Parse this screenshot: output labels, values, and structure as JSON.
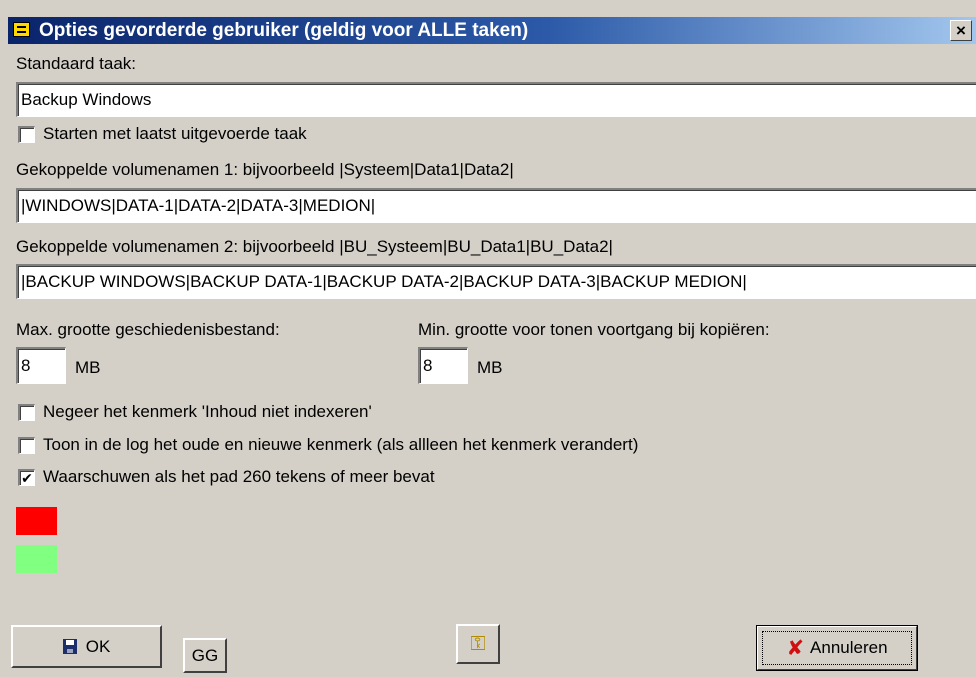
{
  "window": {
    "title": "Opties gevorderde gebruiker  (geldig voor ALLE taken)",
    "close_label": "×"
  },
  "standard_task": {
    "label": "Standaard taak:",
    "value": "Backup Windows"
  },
  "start_last_task": {
    "label": "Starten met laatst uitgevoerde taak",
    "checked": false
  },
  "volumes1": {
    "label": "Gekoppelde volumenamen 1: bijvoorbeeld  |Systeem|Data1|Data2|",
    "value": "|WINDOWS|DATA-1|DATA-2|DATA-3|MEDION|"
  },
  "volumes2": {
    "label": "Gekoppelde volumenamen 2: bijvoorbeeld  |BU_Systeem|BU_Data1|BU_Data2|",
    "value": "|BACKUP WINDOWS|BACKUP DATA-1|BACKUP DATA-2|BACKUP DATA-3|BACKUP MEDION|"
  },
  "history_size": {
    "label": "Max. grootte geschiedenisbestand:",
    "value": "8",
    "unit": "MB"
  },
  "progress_size": {
    "label": "Min. grootte voor tonen voortgang bij kopiëren:",
    "value": "8",
    "unit": "MB"
  },
  "options": [
    {
      "label": "Negeer het kenmerk 'Inhoud niet indexeren'",
      "checked": false,
      "mark": ""
    },
    {
      "label": "Toon in de log het oude en nieuwe kenmerk (als allleen het kenmerk verandert)",
      "checked": false,
      "mark": ""
    },
    {
      "label": "Waarschuwen als het pad 260 tekens of meer bevat",
      "checked": true,
      "mark": "✔"
    }
  ],
  "colors": {
    "swatch_red": "#ff0000",
    "swatch_green": "#80ff80",
    "title_bar": "#0a246a",
    "window_bg": "#d4d0c8"
  },
  "buttons": {
    "ok": "OK",
    "gg": "GG",
    "help_icon": "key-icon",
    "cancel": "Annuleren"
  }
}
